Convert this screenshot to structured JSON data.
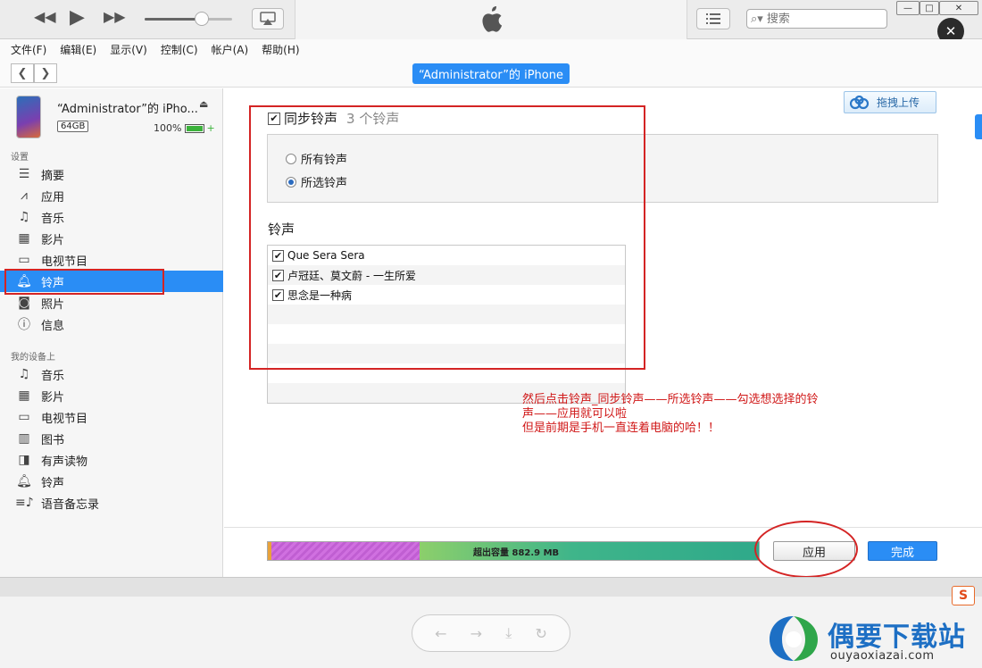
{
  "toolbar": {
    "search_placeholder": "搜索",
    "colors": {
      "accent": "#2a8df5",
      "annotation_red": "#d42424"
    }
  },
  "menu": [
    "文件(F)",
    "编辑(E)",
    "显示(V)",
    "控制(C)",
    "帐户(A)",
    "帮助(H)"
  ],
  "nav": {
    "device_title": "“Administrator”的 iPhone"
  },
  "device": {
    "name": "“Administrator”的 iPho...",
    "capacity": "64GB",
    "battery": "100%",
    "battery_level": 1.0
  },
  "sidebar": {
    "settings_title": "设置",
    "settings_items": [
      {
        "label": "摘要",
        "icon": "summary-icon"
      },
      {
        "label": "应用",
        "icon": "apps-icon"
      },
      {
        "label": "音乐",
        "icon": "music-icon"
      },
      {
        "label": "影片",
        "icon": "film-icon"
      },
      {
        "label": "电视节目",
        "icon": "tv-icon"
      },
      {
        "label": "铃声",
        "icon": "bell-icon",
        "selected": true
      },
      {
        "label": "照片",
        "icon": "camera-icon"
      },
      {
        "label": "信息",
        "icon": "info-icon"
      }
    ],
    "ondevice_title": "我的设备上",
    "ondevice_items": [
      {
        "label": "音乐",
        "icon": "music-icon"
      },
      {
        "label": "影片",
        "icon": "film-icon"
      },
      {
        "label": "电视节目",
        "icon": "tv-icon"
      },
      {
        "label": "图书",
        "icon": "book-icon"
      },
      {
        "label": "有声读物",
        "icon": "audiobook-icon"
      },
      {
        "label": "铃声",
        "icon": "bell-icon"
      },
      {
        "label": "语音备忘录",
        "icon": "voice-memo-icon"
      }
    ]
  },
  "main": {
    "upload_label": "拖拽上传",
    "sync_label": "同步铃声",
    "sync_checked": true,
    "sync_count": "3 个铃声",
    "radio_all": "所有铃声",
    "radio_selected": "所选铃声",
    "radio_value": "selected",
    "ringtones_title": "铃声",
    "ringtones": [
      {
        "name": "Que Sera Sera",
        "checked": true
      },
      {
        "name": "卢冠廷、莫文蔚 - 一生所爱",
        "checked": true
      },
      {
        "name": "思念是一种病",
        "checked": true
      }
    ],
    "annotation_lines": [
      "然后点击铃声_同步铃声——所选铃声——勾选想选择的铃",
      "声——应用就可以啦",
      "但是前期是手机一直连着电脑的哈！！"
    ]
  },
  "footer": {
    "storage_label": "超出容量 882.9 MB",
    "apply_label": "应用",
    "done_label": "完成"
  },
  "watermark": {
    "sogou": "S",
    "title": "偶要下载站",
    "url": "ouyaoxiazai.com"
  }
}
